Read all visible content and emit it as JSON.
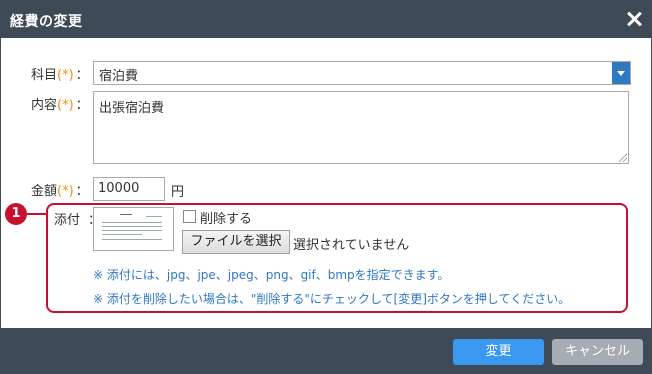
{
  "dialog": {
    "title": "経費の変更"
  },
  "form": {
    "required_mark": "(*)",
    "colon": "：",
    "subject": {
      "label": "科目",
      "value": "宿泊費"
    },
    "content": {
      "label": "内容",
      "value": "出張宿泊費"
    },
    "amount": {
      "label": "金額",
      "value": "10000",
      "unit": "円"
    },
    "attachment": {
      "label": "添付",
      "delete_label": "削除する",
      "choose_file_button": "ファイルを選択",
      "no_file_text": "選択されていません"
    },
    "notes": [
      "※ 添付には、jpg、jpe、jpeg、png、gif、bmpを指定できます。",
      "※ 添付を削除したい場合は、\"削除する\"にチェックして[変更]ボタンを押してください。"
    ]
  },
  "callout": {
    "number": "1"
  },
  "footer": {
    "change_button": "変更",
    "cancel_button": "キャンセル"
  },
  "colors": {
    "titlebar": "#3f4a57",
    "required": "#f28c17",
    "callout": "#c8102e",
    "note": "#2f78c2",
    "primary_button": "#3b98f0",
    "cancel_button": "#a6acb3"
  }
}
